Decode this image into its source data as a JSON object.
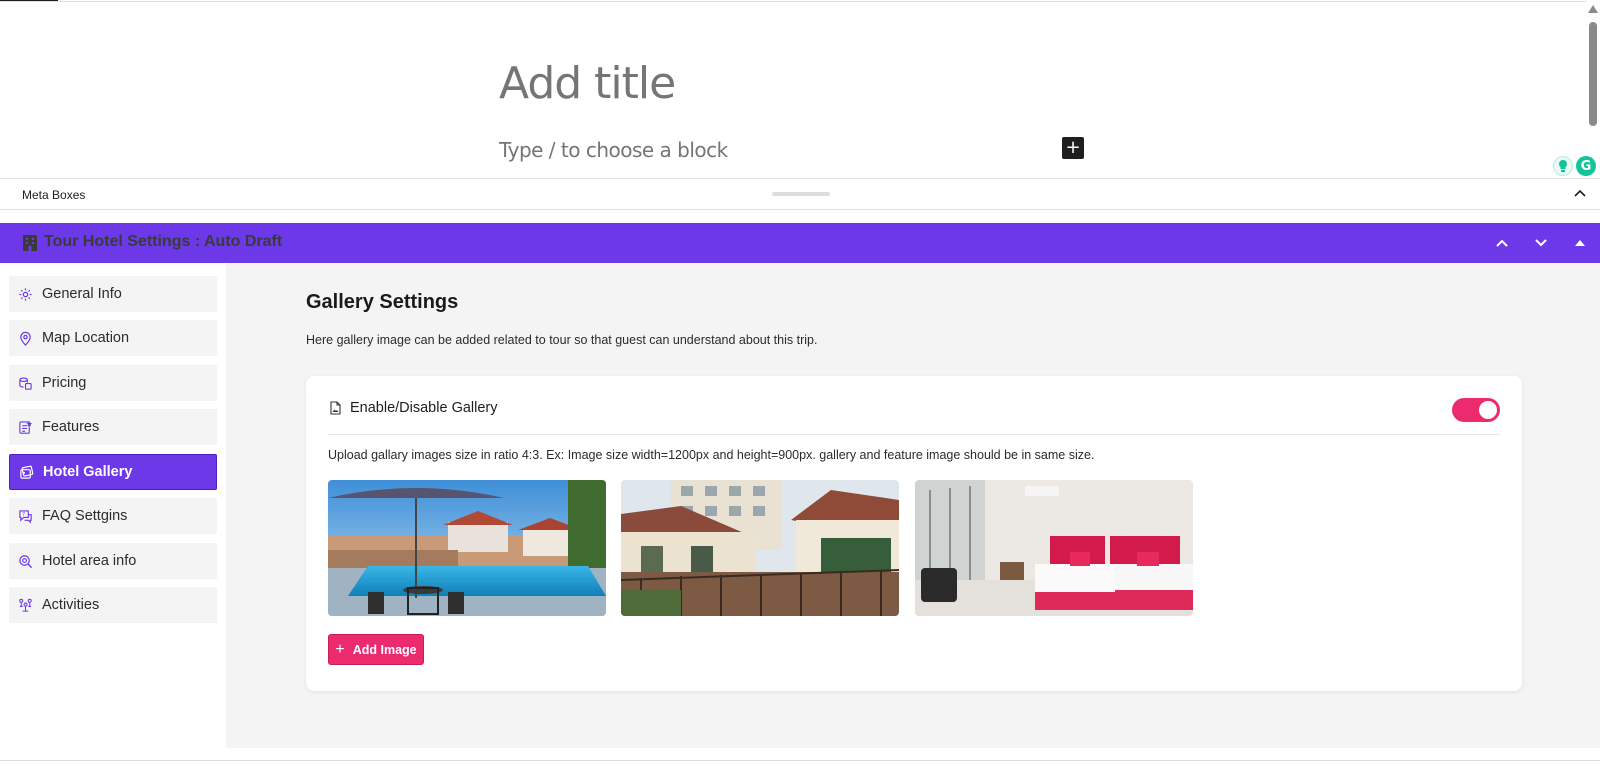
{
  "editor": {
    "title_placeholder": "Add title",
    "block_placeholder": "Type / to choose a block",
    "add_block_symbol": "+"
  },
  "meta": {
    "label": "Meta Boxes"
  },
  "panel": {
    "title": "Tour Hotel Settings : Auto Draft",
    "accent": "#6d38e8"
  },
  "sidebar": {
    "items": [
      {
        "label": "General Info",
        "icon": "gear-icon"
      },
      {
        "label": "Map Location",
        "icon": "map-pin-icon"
      },
      {
        "label": "Pricing",
        "icon": "coins-icon"
      },
      {
        "label": "Features",
        "icon": "features-icon"
      },
      {
        "label": "Hotel Gallery",
        "icon": "gallery-icon",
        "active": true
      },
      {
        "label": "FAQ Settgins",
        "icon": "faq-icon"
      },
      {
        "label": "Hotel area info",
        "icon": "area-search-icon"
      },
      {
        "label": "Activities",
        "icon": "activities-icon"
      }
    ]
  },
  "gallery": {
    "title": "Gallery Settings",
    "description": "Here gallery image can be added related to tour so that guest can understand about this trip.",
    "toggle_label": "Enable/Disable Gallery",
    "toggle_on": true,
    "note": "Upload gallary images size in ratio 4:3. Ex: Image size width=1200px and height=900px. gallery and feature image should be in same size.",
    "images": [
      "pool-photo",
      "building-balcony-photo",
      "bedroom-photo"
    ],
    "add_button": "Add Image",
    "add_symbol": "+",
    "toggle_color": "#ec2b6f"
  }
}
